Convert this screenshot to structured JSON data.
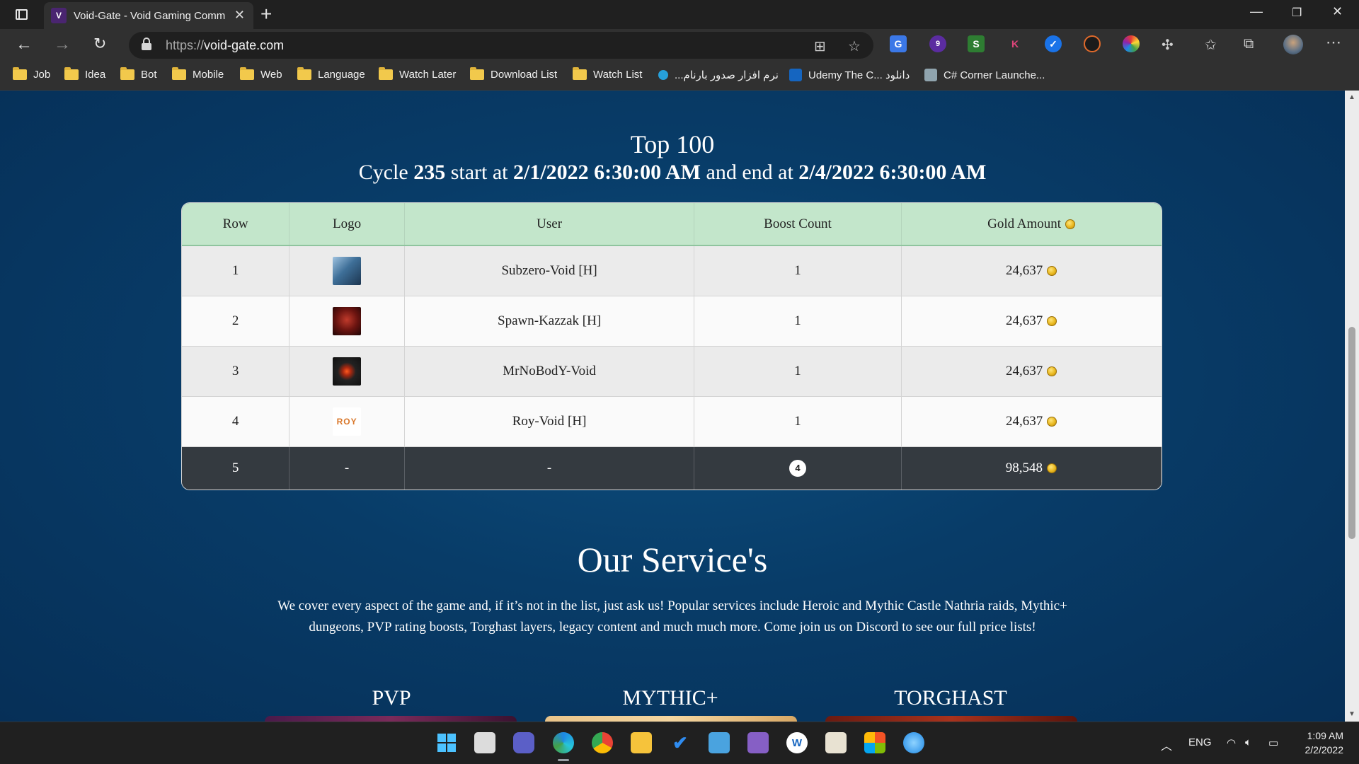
{
  "browser": {
    "tab_title": "Void-Gate - Void Gaming Comm",
    "tab_favicon": "VOID",
    "url_scheme": "https://",
    "url_host": "void-gate.com",
    "extension_badge": "9",
    "bookmarks": [
      {
        "label": "Job",
        "icon": "folder-icon"
      },
      {
        "label": "Idea",
        "icon": "folder-icon"
      },
      {
        "label": "Bot",
        "icon": "folder-icon"
      },
      {
        "label": "Mobile",
        "icon": "folder-icon"
      },
      {
        "label": "Web",
        "icon": "folder-icon"
      },
      {
        "label": "Language",
        "icon": "folder-icon"
      },
      {
        "label": "Watch Later",
        "icon": "folder-icon"
      },
      {
        "label": "Download List",
        "icon": "folder-icon"
      },
      {
        "label": "Watch List",
        "icon": "folder-icon"
      },
      {
        "label": "...نرم افزار صدور بارنام",
        "icon": "site-icon"
      },
      {
        "label": "Udemy The C... دانلود",
        "icon": "site-icon"
      },
      {
        "label": "C# Corner Launche...",
        "icon": "site-icon"
      }
    ]
  },
  "leaderboard": {
    "title": "Top 100",
    "cycle_prefix": "Cycle",
    "cycle_number": "235",
    "start_text": "start at",
    "start_date": "2/1/2022 6:30:00 AM",
    "end_text": "and end at",
    "end_date": "2/4/2022 6:30:00 AM",
    "columns": [
      "Row",
      "Logo",
      "User",
      "Boost Count",
      "Gold Amount"
    ],
    "rows": [
      {
        "row": "1",
        "user": "Subzero-Void [H]",
        "boost": "1",
        "gold": "24,637"
      },
      {
        "row": "2",
        "user": "Spawn-Kazzak [H]",
        "boost": "1",
        "gold": "24,637"
      },
      {
        "row": "3",
        "user": "MrNoBodY-Void",
        "boost": "1",
        "gold": "24,637"
      },
      {
        "row": "4",
        "user": "Roy-Void [H]",
        "boost": "1",
        "gold": "24,637"
      }
    ],
    "total": {
      "row": "5",
      "logo": "-",
      "user": "-",
      "boost": "4",
      "gold": "98,548"
    },
    "roy_logo_text": "ROY"
  },
  "services": {
    "title": "Our Service's",
    "description": "We cover every aspect of the game and, if it’s not in the list, just ask us! Popular services include Heroic and Mythic Castle Nathria raids, Mythic+ dungeons, PVP rating boosts, Torghast layers, legacy content and much much more. Come join us on Discord to see our full price lists!",
    "items": [
      "PVP",
      "MYTHIC+",
      "TORGHAST"
    ]
  },
  "taskbar": {
    "language": "ENG",
    "time": "1:09 AM",
    "date": "2/2/2022"
  },
  "colors": {
    "table_header": "#c3e6cb",
    "total_row": "#343a40",
    "page_background": "#083c68"
  }
}
